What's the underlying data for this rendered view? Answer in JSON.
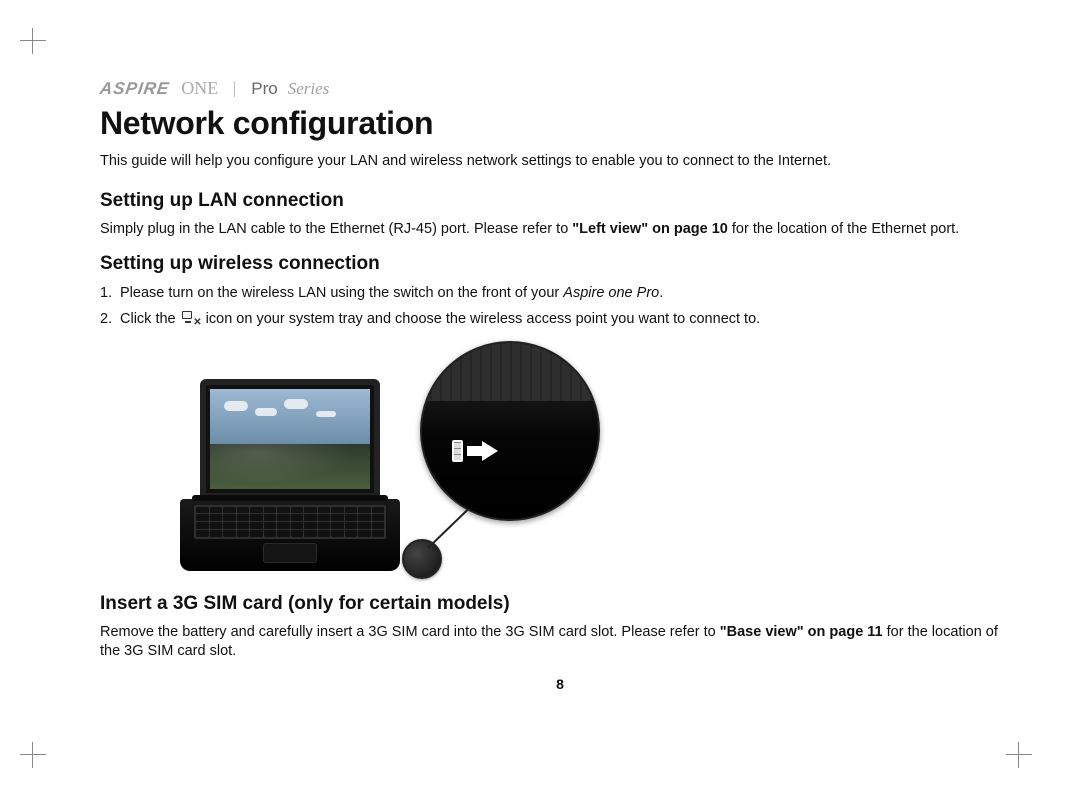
{
  "brand": {
    "aspire": "ASPIRE",
    "one": "ONE",
    "pro": "Pro",
    "series": "Series"
  },
  "title": "Network configuration",
  "intro": "This guide will help you configure your LAN and wireless network settings to enable you to connect to the Internet.",
  "section_lan": {
    "heading": "Setting up LAN connection",
    "text_before_ref": "Simply plug in the LAN cable to the Ethernet (RJ-45) port. Please refer to ",
    "ref": "\"Left view\" on page 10",
    "text_after_ref": " for the location of the Ethernet port."
  },
  "section_wireless": {
    "heading": "Setting up wireless connection",
    "step1_before_italic": "Please turn on the wireless LAN using the switch on the front of your ",
    "step1_italic": "Aspire one Pro",
    "step1_after_italic": ".",
    "step2_before_icon": "Click the ",
    "step2_after_icon": " icon on your system tray and choose the wireless access point you want to connect to."
  },
  "section_sim": {
    "heading": "Insert a 3G SIM card (only for certain models)",
    "text_before_ref": "Remove the battery and carefully insert a 3G SIM card into the 3G SIM card slot. Please refer to ",
    "ref": "\"Base view\" on page 11",
    "text_after_ref": " for the location of the 3G SIM card slot."
  },
  "page_number": "8",
  "figure": {
    "alt": "Netbook with magnified inset of the wireless switch on the front edge, arrow indicating slide direction"
  }
}
